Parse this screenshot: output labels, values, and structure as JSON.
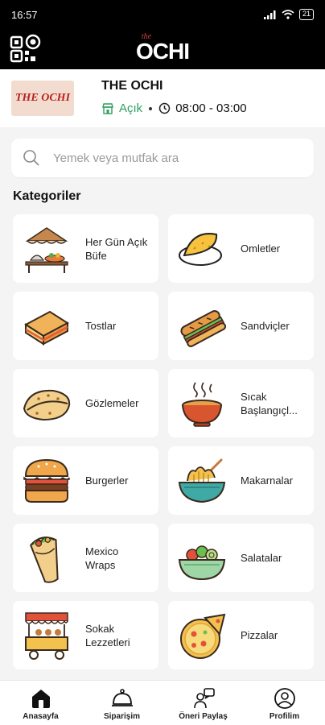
{
  "status": {
    "time": "16:57",
    "battery": "21"
  },
  "app": {
    "logo_small": "the",
    "logo_main": "OCHI"
  },
  "restaurant": {
    "logo_text": "THE OCHI",
    "name": "THE OCHI",
    "status": "Açık",
    "hours": "08:00 - 03:00",
    "open_color": "#2e9e5f"
  },
  "search": {
    "placeholder": "Yemek veya mutfak ara"
  },
  "categories_title": "Kategoriler",
  "categories": [
    {
      "label": "Her Gün Açık Büfe",
      "icon": "buffet-icon"
    },
    {
      "label": "Omletler",
      "icon": "omelette-icon"
    },
    {
      "label": "Tostlar",
      "icon": "toast-sandwich-icon"
    },
    {
      "label": "Sandviçler",
      "icon": "sub-sandwich-icon"
    },
    {
      "label": "Gözlemeler",
      "icon": "gozleme-icon"
    },
    {
      "label": "Sıcak Başlangıçl...",
      "icon": "soup-bowl-icon"
    },
    {
      "label": "Burgerler",
      "icon": "burger-icon"
    },
    {
      "label": "Makarnalar",
      "icon": "pasta-icon"
    },
    {
      "label": "Mexico Wraps",
      "icon": "wrap-icon"
    },
    {
      "label": "Salatalar",
      "icon": "salad-icon"
    },
    {
      "label": "Sokak Lezzetleri",
      "icon": "food-cart-icon"
    },
    {
      "label": "Pizzalar",
      "icon": "pizza-icon"
    }
  ],
  "nav": [
    {
      "label": "Anasayfa",
      "icon": "home-icon"
    },
    {
      "label": "Siparişim",
      "icon": "cloche-icon"
    },
    {
      "label": "Öneri Paylaş",
      "icon": "suggestion-icon"
    },
    {
      "label": "Profilim",
      "icon": "profile-icon"
    }
  ]
}
